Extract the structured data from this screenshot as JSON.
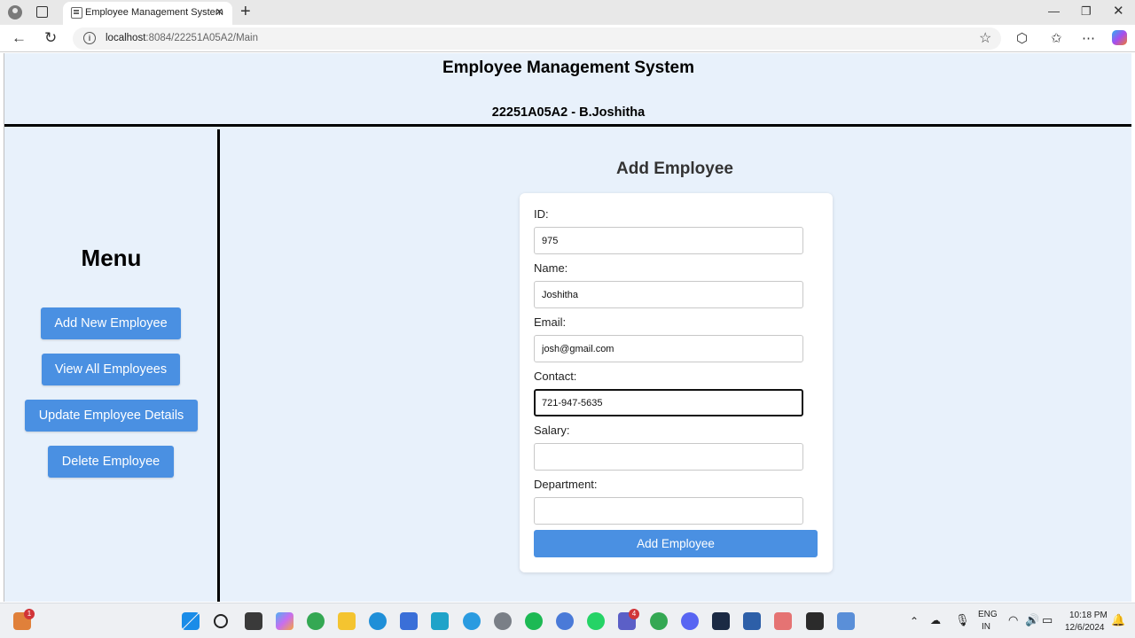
{
  "browser": {
    "tab_title": "Employee Management System",
    "url_host": "localhost",
    "url_path": ":8084/22251A05A2/Main"
  },
  "header": {
    "title": "Employee Management System",
    "subtitle": "22251A05A2 - B.Joshitha"
  },
  "sidebar": {
    "menu_title": "Menu",
    "items": [
      {
        "label": "Add New Employee"
      },
      {
        "label": "View All Employees"
      },
      {
        "label": "Update Employee Details"
      },
      {
        "label": "Delete Employee"
      }
    ]
  },
  "form": {
    "title": "Add Employee",
    "fields": [
      {
        "label": "ID:",
        "value": "975"
      },
      {
        "label": "Name:",
        "value": "Joshitha"
      },
      {
        "label": "Email:",
        "value": "josh@gmail.com"
      },
      {
        "label": "Contact:",
        "value": "721-947-5635"
      },
      {
        "label": "Salary:",
        "value": ""
      },
      {
        "label": "Department:",
        "value": ""
      }
    ],
    "submit_label": "Add Employee"
  },
  "taskbar": {
    "language": "ENG",
    "region": "IN",
    "time": "10:18 PM",
    "date": "12/6/2024",
    "widget_badge": "1",
    "teams_badge": "4"
  },
  "colors": {
    "page_bg": "#e8f1fb",
    "accent": "#4a90e2"
  }
}
